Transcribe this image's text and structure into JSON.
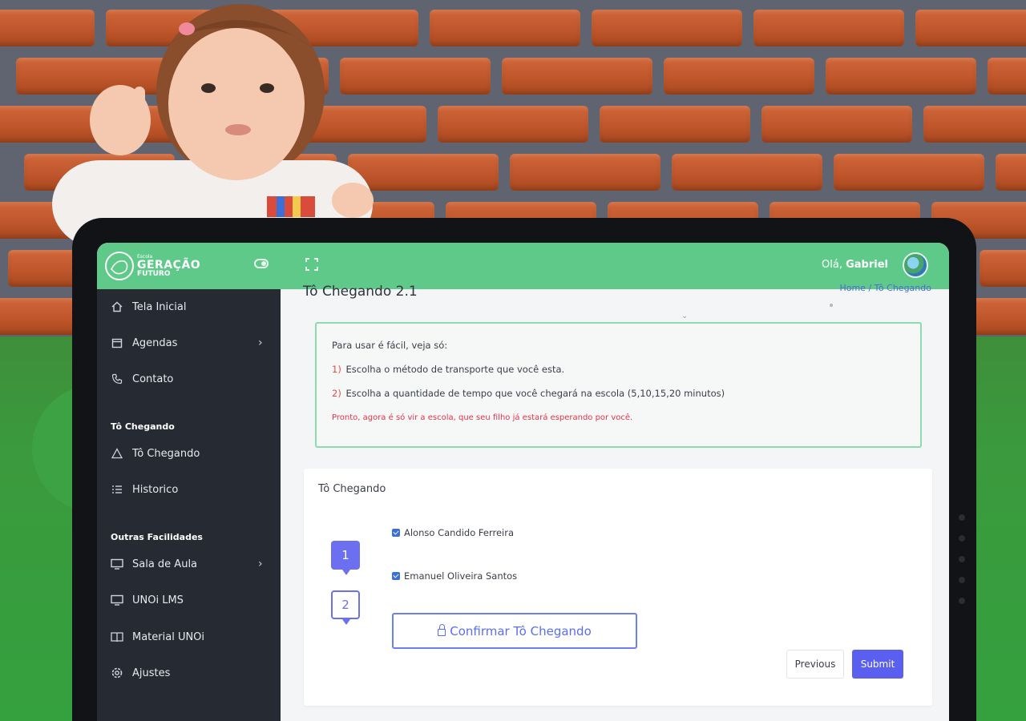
{
  "header": {
    "logo_small": "Escola",
    "logo_big": "GERAÇÃO",
    "logo_sub": "FUTURO",
    "greeting_prefix": "Olá,",
    "user_name": "Gabriel"
  },
  "sidebar": {
    "items": [
      {
        "label": "Tela Inicial",
        "icon": "home-icon"
      },
      {
        "label": "Agendas",
        "icon": "calendar-icon"
      },
      {
        "label": "Contato",
        "icon": "phone-icon"
      }
    ],
    "section_1": "Tô Chegando",
    "section_1_items": [
      {
        "label": "Tô Chegando",
        "icon": "alert-triangle-icon"
      },
      {
        "label": "Historico",
        "icon": "list-icon"
      }
    ],
    "section_2": "Outras Facilidades",
    "section_2_items": [
      {
        "label": "Sala de Aula",
        "icon": "monitor-icon"
      },
      {
        "label": "UNOi LMS",
        "icon": "monitor-icon"
      },
      {
        "label": "Material UNOi",
        "icon": "book-icon"
      },
      {
        "label": "Ajustes",
        "icon": "gear-icon"
      }
    ]
  },
  "main": {
    "page_title": "Tô Chegando 2.1",
    "breadcrumb": "Home / Tô Chegando"
  },
  "info": {
    "intro": "Para usar é fácil, veja só:",
    "step1_num": "1)",
    "step1": "Escolha o método de transporte que você esta.",
    "step2_num": "2)",
    "step2": "Escolha a quantidade de tempo que você chegará na escola (5,10,15,20 minutos)",
    "warning": "Pronto, agora é só vir a escola, que seu filho já estará esperando por você."
  },
  "wizard": {
    "title": "Tô Chegando",
    "step1": "1",
    "step2": "2",
    "students": [
      "Alonso Candido Ferreira",
      "Emanuel Oliveira Santos"
    ],
    "confirm_label": "Confirmar Tô Chegando",
    "previous_label": "Previous",
    "submit_label": "Submit"
  }
}
